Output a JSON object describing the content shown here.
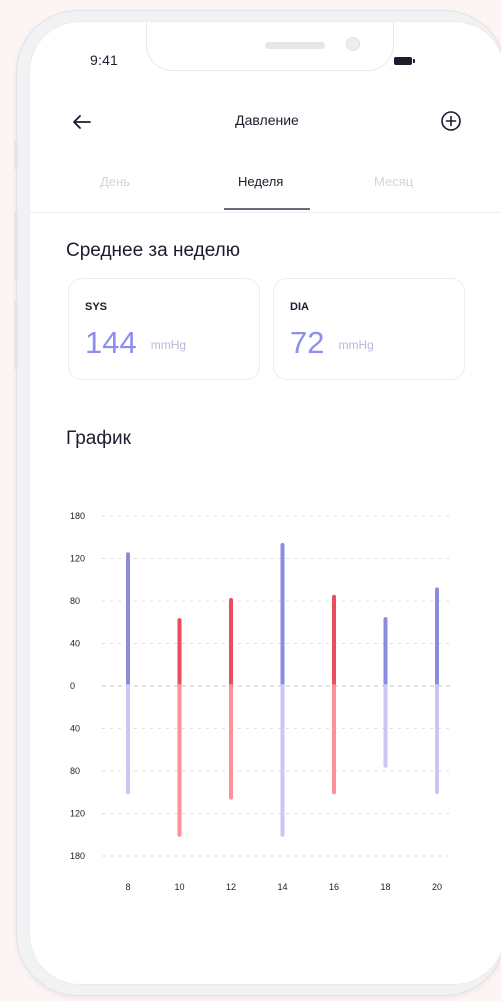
{
  "status_bar": {
    "time": "9:41"
  },
  "header": {
    "title": "Давление"
  },
  "tabs": [
    {
      "label": "День",
      "active": false
    },
    {
      "label": "Неделя",
      "active": true
    },
    {
      "label": "Месяц",
      "active": false
    }
  ],
  "weekly_average": {
    "title": "Среднее за неделю",
    "cards": [
      {
        "label": "SYS",
        "value": "144",
        "unit": "mmHg"
      },
      {
        "label": "DIA",
        "value": "72",
        "unit": "mmHg"
      }
    ]
  },
  "graph": {
    "title": "График"
  },
  "colors": {
    "normal_top": "#8b8be0",
    "normal_bottom": "#c8c8f0",
    "alert_top": "#e84e5e",
    "alert_bottom": "#ff8f9a",
    "accent_value": "#8e8ef0"
  },
  "chart_data": {
    "type": "bar",
    "y_tick_labels_top": [
      "180",
      "120",
      "80",
      "40"
    ],
    "y_zero_label": "0",
    "y_tick_labels_bottom": [
      "40",
      "80",
      "120",
      "180"
    ],
    "y_scale": "non-linear (ticks evenly spaced)",
    "categories": [
      "8",
      "10",
      "12",
      "14",
      "16",
      "18",
      "20"
    ],
    "series": [
      {
        "values": [
          126,
          62,
          81,
          139,
          84,
          63,
          91
        ]
      },
      {
        "values": [
          100,
          150,
          105,
          150,
          100,
          75,
          100
        ]
      }
    ],
    "alert": [
      false,
      true,
      true,
      false,
      true,
      false,
      false
    ],
    "grid": "dashed horizontal"
  }
}
